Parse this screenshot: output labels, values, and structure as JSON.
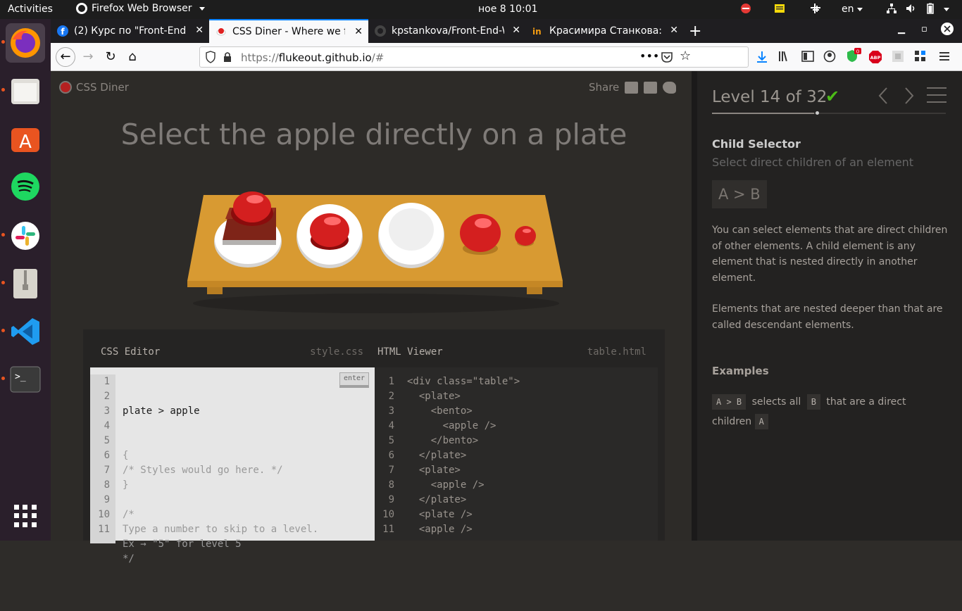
{
  "topbar": {
    "activities": "Activities",
    "app_name": "Firefox Web Browser",
    "datetime": "ное 8  10:01",
    "language": "en"
  },
  "tabs": [
    {
      "label": "(2) Курс по \"Front-End W",
      "icon": "facebook-icon"
    },
    {
      "label": "CSS Diner - Where we fe",
      "icon": "css-diner-icon"
    },
    {
      "label": "kpstankova/Front-End-W",
      "icon": "github-icon"
    },
    {
      "label": "Красимира Станкова: П",
      "icon": "linkedin-icon"
    }
  ],
  "urlbar": {
    "scheme": "https://",
    "host": "flukeout.github.io",
    "path": "/#"
  },
  "extensions": {
    "badge_count": "0",
    "abp": "ABP"
  },
  "game": {
    "brand": "CSS Diner",
    "share": "Share",
    "order": "Select the apple directly on a plate"
  },
  "editor": {
    "css_title": "CSS Editor",
    "css_file": "style.css",
    "html_title": "HTML Viewer",
    "html_file": "table.html",
    "enter": "enter",
    "input_value": "plate > apple",
    "css_lines": [
      "{",
      "/* Styles would go here. */",
      "}",
      "",
      "/*",
      "Type a number to skip to a level.",
      "Ex → \"5\" for level 5",
      "*/",
      ""
    ],
    "line_numbers": [
      "1",
      "2",
      "3",
      "4",
      "5",
      "6",
      "7",
      "8",
      "9",
      "10",
      "11"
    ],
    "html_lines": [
      "<div class=\"table\">",
      "  <plate>",
      "    <bento>",
      "      <apple />",
      "    </bento>",
      "  </plate>",
      "  <plate>",
      "    <apple />",
      "  </plate>",
      "  <plate />",
      "  <apple />"
    ]
  },
  "sidebar": {
    "level_label": "Level 14 of 32",
    "check": "✔",
    "selector_name": "Child Selector",
    "selector_title": "Select direct children of an element",
    "syntax": "A > B",
    "hint_1": "You can select elements that are direct children of other elements. A child element is any element that is nested directly in another element.",
    "hint_2": "Elements that are nested deeper than that are called descendant elements.",
    "examples_title": "Examples",
    "example": {
      "tag1": "A > B",
      "text1": "selects all",
      "tag2": "B",
      "text2": "that are a direct children",
      "tag3": "A"
    },
    "progress": 0.4375
  },
  "colors": {
    "table": "#d89a32",
    "apple": "#d41f1f",
    "plate": "#ffffff",
    "bento": "#8a2a1c",
    "check": "#4cbb17"
  }
}
